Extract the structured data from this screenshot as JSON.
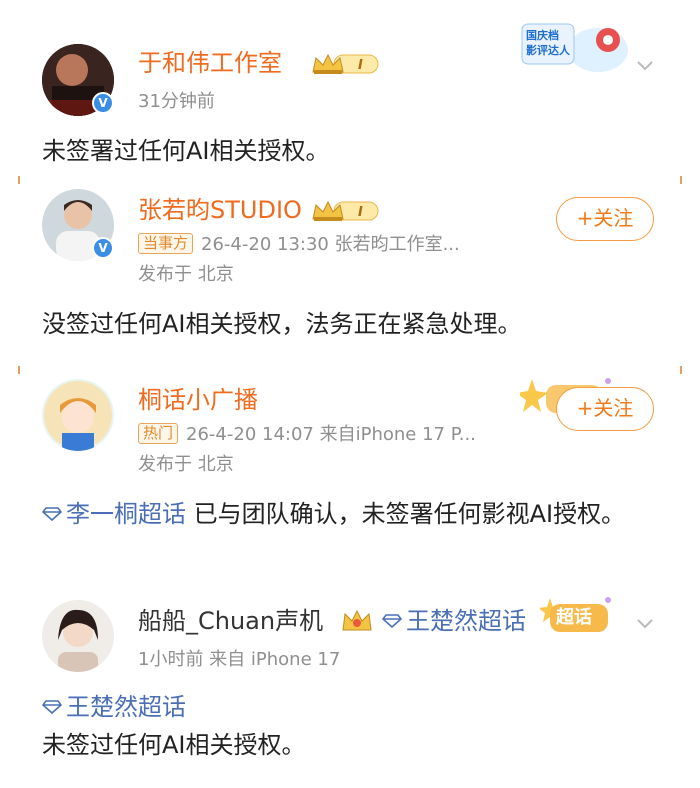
{
  "posts": [
    {
      "name": "于和伟工作室",
      "time": "31分钟前",
      "level": "I",
      "corner_badge": "国庆档 影评达人",
      "content": "未签署过任何AI相关授权。"
    },
    {
      "name": "张若昀STUDIO",
      "tag": "当事方",
      "meta": "26-4-20 13:30  张若昀工作室...",
      "location": "发布于 北京",
      "level": "I",
      "follow_label": "+关注",
      "content": "没签过任何AI相关授权，法务正在紧急处理。"
    },
    {
      "name": "桐话小广播",
      "tag": "热门",
      "meta": "26-4-20 14:07  来自iPhone 17 P...",
      "location": "发布于 北京",
      "follow_label": "+关注",
      "topic": "李一桐超话",
      "content": " 已与团队确认，未签署任何影视AI授权。"
    },
    {
      "name": "船船_Chuan声机",
      "topic_inline": "王楚然超话",
      "meta": "1小时前  来自 iPhone 17",
      "badge": "超话",
      "topic": "王楚然超话",
      "content": "未签过任何AI相关授权。"
    }
  ],
  "colors": {
    "name_orange": "#f06b1e",
    "topic_blue": "#4a6fb5",
    "meta_gray": "#8f8f8f",
    "follow_orange": "#f07a1a",
    "verified_blue": "#3a8ee6"
  }
}
